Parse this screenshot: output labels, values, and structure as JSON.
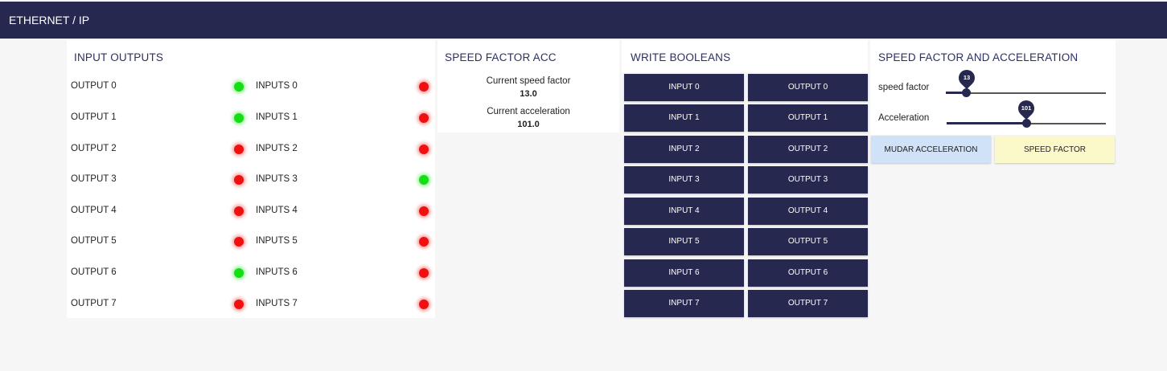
{
  "header": {
    "title": "ETHERNET / IP"
  },
  "io_panel": {
    "title": "INPUT OUTPUTS",
    "rows": [
      {
        "output": "OUTPUT 0",
        "output_state": "on",
        "input": "INPUTS 0",
        "input_state": "off"
      },
      {
        "output": "OUTPUT 1",
        "output_state": "on",
        "input": "INPUTS 1",
        "input_state": "off"
      },
      {
        "output": "OUTPUT 2",
        "output_state": "off",
        "input": "INPUTS 2",
        "input_state": "off"
      },
      {
        "output": "OUTPUT 3",
        "output_state": "off",
        "input": "INPUTS 3",
        "input_state": "on"
      },
      {
        "output": "OUTPUT 4",
        "output_state": "off",
        "input": "INPUTS 4",
        "input_state": "off"
      },
      {
        "output": "OUTPUT 5",
        "output_state": "off",
        "input": "INPUTS 5",
        "input_state": "off"
      },
      {
        "output": "OUTPUT 6",
        "output_state": "on",
        "input": "INPUTS 6",
        "input_state": "off"
      },
      {
        "output": "OUTPUT 7",
        "output_state": "off",
        "input": "INPUTS 7",
        "input_state": "off"
      }
    ],
    "colors": {
      "on": "#12e012",
      "off": "#f01010"
    }
  },
  "speed_factor_acc": {
    "title": "SPEED FACTOR ACC",
    "speed_label": "Current speed factor",
    "speed_value": "13.0",
    "acc_label": "Current acceleration",
    "acc_value": "101.0"
  },
  "write_booleans": {
    "title": "WRITE BOOLEANS",
    "inputs": [
      "INPUT 0",
      "INPUT 1",
      "INPUT 2",
      "INPUT 3",
      "INPUT 4",
      "INPUT 5",
      "INPUT 6",
      "INPUT 7"
    ],
    "outputs": [
      "OUTPUT 0",
      "OUTPUT 1",
      "OUTPUT 2",
      "OUTPUT 3",
      "OUTPUT 4",
      "OUTPUT 5",
      "OUTPUT 6",
      "OUTPUT 7"
    ]
  },
  "speed_and_acceleration": {
    "title": "SPEED FACTOR AND ACCELERATION",
    "speed_slider": {
      "label": "speed factor",
      "value": "13",
      "fraction": 0.13
    },
    "acc_slider": {
      "label": "Acceleration",
      "value": "101",
      "fraction": 0.5
    },
    "button_acc": "MUDAR ACCELERATION",
    "button_speed": "SPEED FACTOR"
  },
  "theme": {
    "primary": "#262850",
    "acc_button": "#cfe2f7",
    "speed_button": "#fbf9c9"
  }
}
